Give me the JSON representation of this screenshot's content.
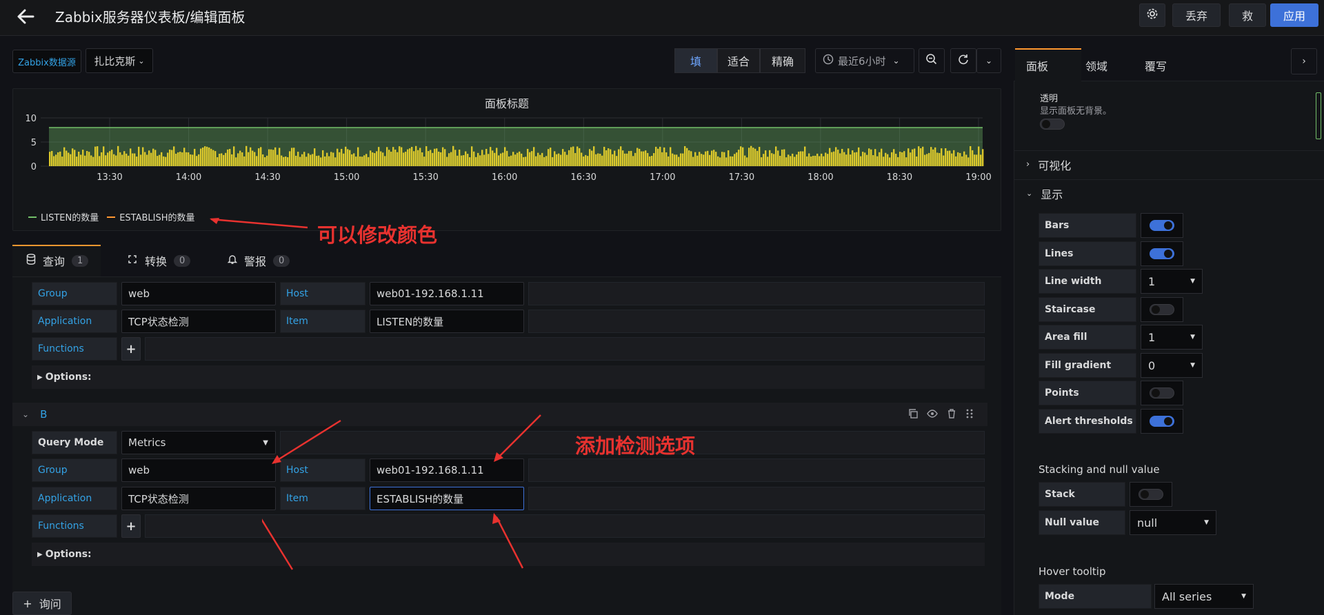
{
  "header": {
    "title": "Zabbix服务器仪表板/编辑面板",
    "discard_label": "丢弃",
    "save_label": "救",
    "apply_label": "应用"
  },
  "toolbar": {
    "datasource_label": "Zabbix数据源",
    "datasource_value": "扎比克斯",
    "fill_label": "填",
    "fit_label": "适合",
    "exact_label": "精确",
    "time_range": "最近6小时"
  },
  "panel": {
    "title": "面板标题",
    "legend": [
      "LISTEN的数量",
      "ESTABLISH的数量"
    ]
  },
  "chart_data": {
    "type": "area",
    "title": "面板标题",
    "x_ticks": [
      "13:30",
      "14:00",
      "14:30",
      "15:00",
      "15:30",
      "16:00",
      "16:30",
      "17:00",
      "17:30",
      "18:00",
      "18:30",
      "19:00"
    ],
    "y_ticks": [
      0,
      5,
      10
    ],
    "ylim": [
      0,
      10
    ],
    "series": [
      {
        "name": "LISTEN的数量",
        "color": "#73bf69",
        "values": [
          8,
          8,
          8,
          8,
          8,
          8,
          8,
          8,
          8,
          8,
          8,
          8
        ]
      },
      {
        "name": "ESTABLISH的数量",
        "color": "#fade2a",
        "values": [
          3,
          3,
          3,
          3,
          3,
          3,
          3,
          3,
          3,
          3,
          3,
          3
        ]
      }
    ]
  },
  "query_tabs": [
    {
      "label": "查询",
      "count": "1"
    },
    {
      "label": "转换",
      "count": "0"
    },
    {
      "label": "警报",
      "count": "0"
    }
  ],
  "query_a": {
    "group_label": "Group",
    "group_value": "web",
    "host_label": "Host",
    "host_value": "web01-192.168.1.11",
    "application_label": "Application",
    "application_value": "TCP状态检测",
    "item_label": "Item",
    "item_value": "LISTEN的数量",
    "functions_label": "Functions",
    "options_label": "Options:"
  },
  "query_b": {
    "name": "B",
    "query_mode_label": "Query Mode",
    "query_mode_value": "Metrics",
    "group_label": "Group",
    "group_value": "web",
    "host_label": "Host",
    "host_value": "web01-192.168.1.11",
    "application_label": "Application",
    "application_value": "TCP状态检测",
    "item_label": "Item",
    "item_value": "ESTABLISH的数量",
    "functions_label": "Functions",
    "options_label": "Options:"
  },
  "add_query_label": "询问",
  "annotations": {
    "color_hint": "可以修改颜色",
    "add_hint": "添加检测选项"
  },
  "right": {
    "tabs": [
      "面板",
      "领域",
      "覆写"
    ],
    "transparent_title": "透明",
    "transparent_desc": "显示面板无背景。",
    "visualization_label": "可视化",
    "display_label": "显示",
    "display_options": [
      {
        "label": "Bars",
        "type": "switch",
        "on": true
      },
      {
        "label": "Lines",
        "type": "switch",
        "on": true
      },
      {
        "label": "Line width",
        "type": "select",
        "value": "1"
      },
      {
        "label": "Staircase",
        "type": "switch",
        "on": false
      },
      {
        "label": "Area fill",
        "type": "select",
        "value": "1"
      },
      {
        "label": "Fill gradient",
        "type": "select",
        "value": "0"
      },
      {
        "label": "Points",
        "type": "switch",
        "on": false
      },
      {
        "label": "Alert thresholds",
        "type": "switch",
        "on": true
      }
    ],
    "stacking_title": "Stacking and null value",
    "stack_label": "Stack",
    "null_value_label": "Null value",
    "null_value": "null",
    "hover_title": "Hover tooltip",
    "mode_label": "Mode",
    "mode_value": "All series"
  }
}
